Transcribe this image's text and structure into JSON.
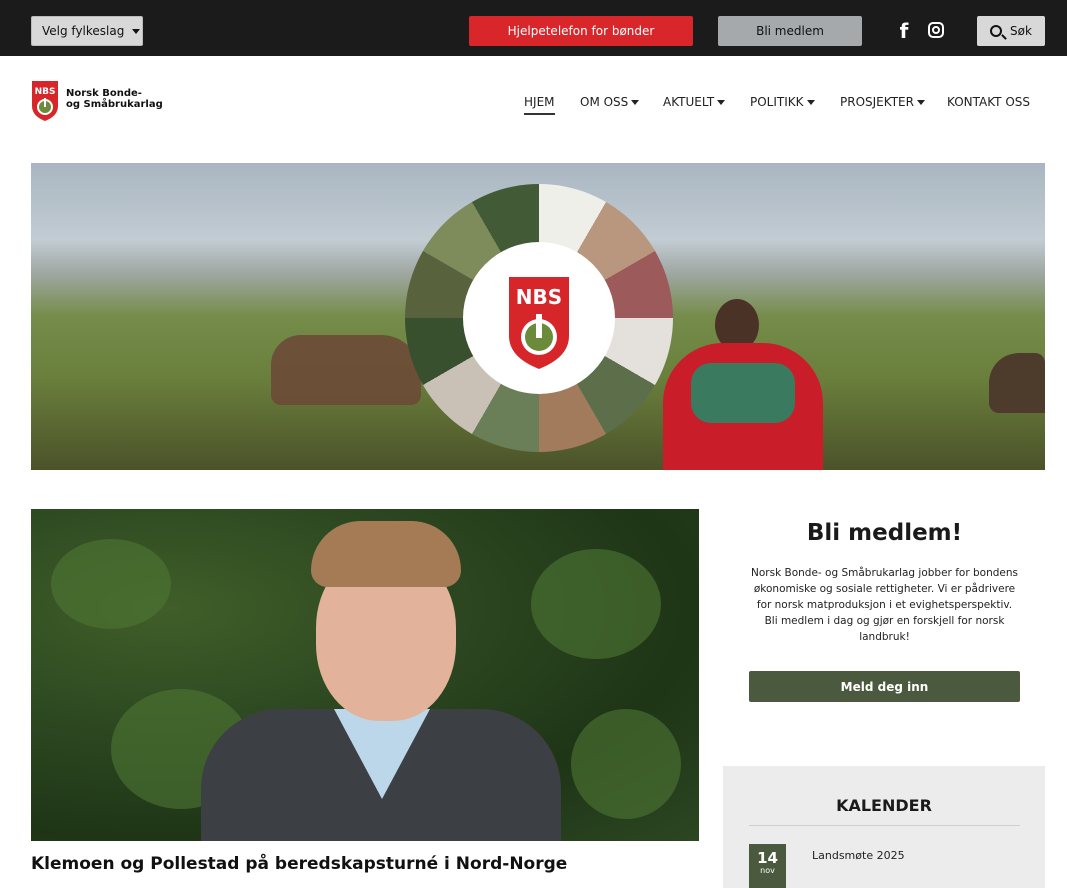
{
  "topbar": {
    "fylke_label": "Velg fylkeslag",
    "hjelp_label": "Hjelpetelefon for bønder",
    "medlem_label": "Bli medlem",
    "facebook_glyph": "f",
    "search_label": "Søk"
  },
  "header": {
    "org_line1": "Norsk Bonde-",
    "org_line2": "og Småbrukarlag",
    "logo_text": "NBS"
  },
  "nav": [
    {
      "label": "HJEM",
      "active": true,
      "dropdown": false
    },
    {
      "label": "OM OSS",
      "active": false,
      "dropdown": true
    },
    {
      "label": "AKTUELT",
      "active": false,
      "dropdown": true
    },
    {
      "label": "POLITIKK",
      "active": false,
      "dropdown": true
    },
    {
      "label": "PROSJEKTER",
      "active": false,
      "dropdown": true
    },
    {
      "label": "KONTAKT OSS",
      "active": false,
      "dropdown": false
    }
  ],
  "article": {
    "title": "Klemoen og Pollestad på beredskapsturné i Nord-Norge"
  },
  "membership": {
    "title": "Bli medlem!",
    "text": "Norsk Bonde- og Småbrukarlag jobber for bondens økonomiske og sosiale rettigheter. Vi er pådrivere for norsk matproduksjon i et evighetsperspektiv. Bli medlem i dag og gjør en forskjell for norsk landbruk!",
    "button_label": "Meld deg inn"
  },
  "calendar": {
    "title": "KALENDER",
    "events": [
      {
        "day": "14",
        "month": "nov",
        "title": "Landsmøte 2025"
      }
    ]
  },
  "colors": {
    "topbar": "#1b1b1b",
    "hjelp_red": "#d9262a",
    "brand_green": "#4b5a3e",
    "shield_red": "#d7262a"
  }
}
